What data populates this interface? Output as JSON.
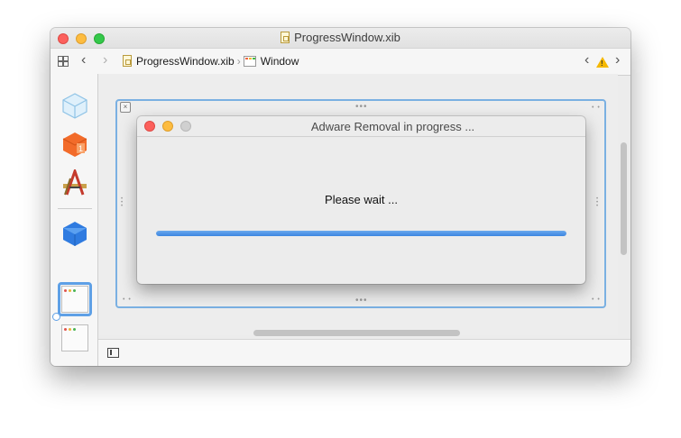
{
  "window": {
    "title": "ProgressWindow.xib"
  },
  "toolbar": {
    "breadcrumb": [
      {
        "label": "ProgressWindow.xib",
        "icon": "xib-file-icon"
      },
      {
        "label": "Window",
        "icon": "window-icon"
      }
    ]
  },
  "sidebar": {
    "items": [
      {
        "icon": "object-cube-icon"
      },
      {
        "icon": "first-responder-icon"
      },
      {
        "icon": "application-icon"
      },
      {
        "icon": "blue-cube-icon"
      },
      {
        "icon": "window-thumbnail-icon",
        "selected": true
      },
      {
        "icon": "window-thumbnail-icon",
        "selected": false
      }
    ]
  },
  "dialog": {
    "title": "Adware Removal in progress ...",
    "message": "Please wait ...",
    "progress": 1.0
  },
  "colors": {
    "accent": "#3c86e0",
    "selection": "#7ab0e2",
    "close": "#fc605c",
    "minimize": "#fdbc40",
    "zoom": "#34c84a"
  }
}
